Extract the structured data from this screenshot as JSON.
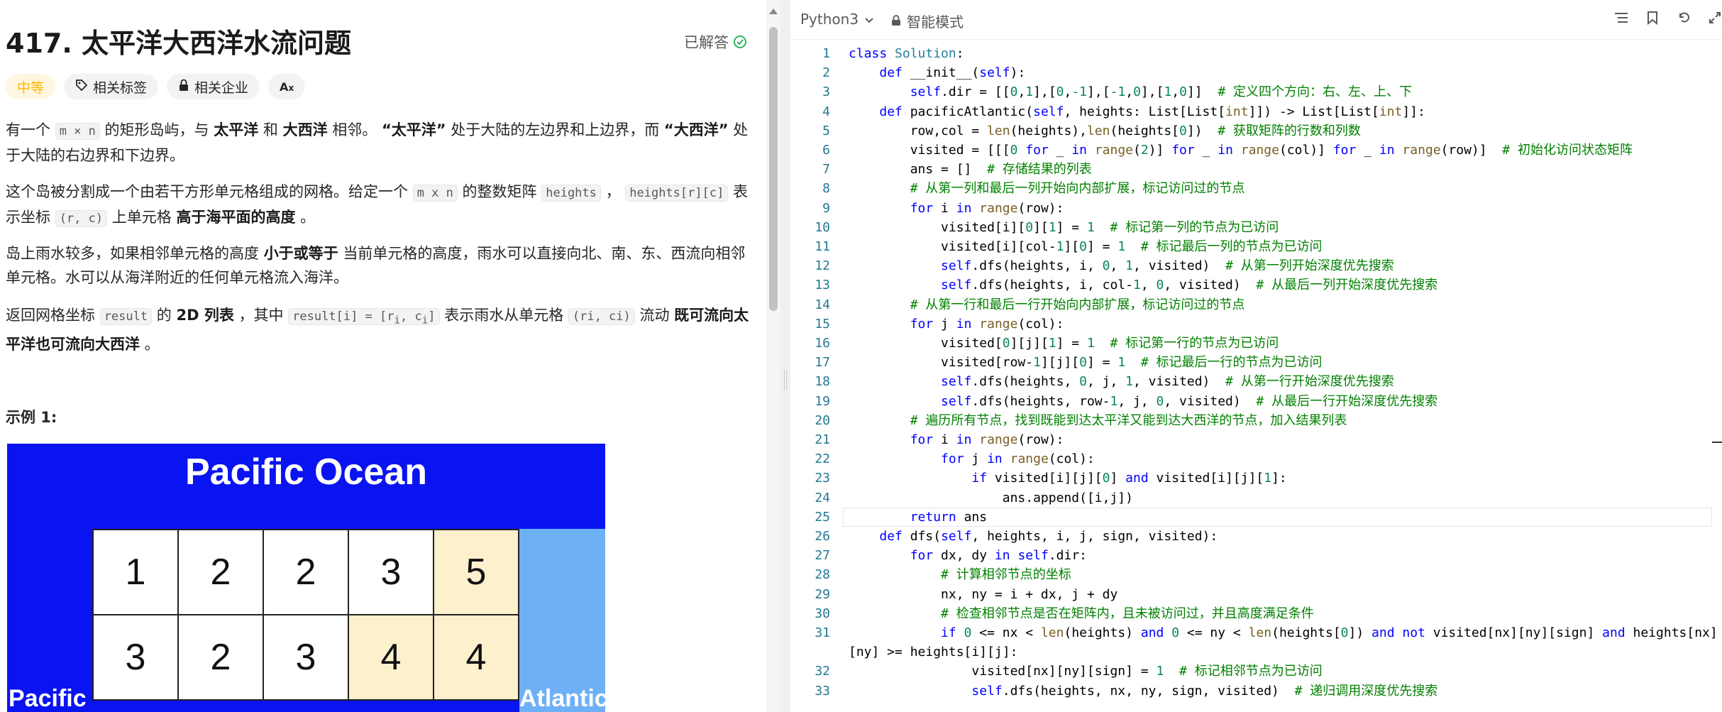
{
  "problem": {
    "title": "417. 太平洋大西洋水流问题",
    "status": "已解答",
    "difficulty": "中等",
    "tags": [
      "相关标签",
      "相关企业",
      "Aあ"
    ],
    "example_title": "示例 1:"
  },
  "example_image": {
    "top_label": "Pacific Ocean",
    "left_label": "Pacific",
    "right_label": "Atlantic",
    "cells": [
      {
        "v": "1",
        "hl": false
      },
      {
        "v": "2",
        "hl": false
      },
      {
        "v": "2",
        "hl": false
      },
      {
        "v": "3",
        "hl": false
      },
      {
        "v": "5",
        "hl": true
      },
      {
        "v": "3",
        "hl": false
      },
      {
        "v": "2",
        "hl": false
      },
      {
        "v": "3",
        "hl": false
      },
      {
        "v": "4",
        "hl": true
      },
      {
        "v": "4",
        "hl": true
      }
    ]
  },
  "editor": {
    "language": "Python3",
    "mode": "智能模式",
    "lines": [
      "class Solution:",
      "    def __init__(self):",
      "        self.dir = [[0,1],[0,-1],[-1,0],[1,0]]  # 定义四个方向：右、左、上、下",
      "    def pacificAtlantic(self, heights: List[List[int]]) -> List[List[int]]:",
      "        row,col = len(heights),len(heights[0])  # 获取矩阵的行数和列数",
      "        visited = [[[0 for _ in range(2)] for _ in range(col)] for _ in range(row)]  # 初始化访问状态矩阵",
      "        ans = []  # 存储结果的列表",
      "        # 从第一列和最后一列开始向内部扩展，标记访问过的节点",
      "        for i in range(row):",
      "            visited[i][0][1] = 1  # 标记第一列的节点为已访问",
      "            visited[i][col-1][0] = 1  # 标记最后一列的节点为已访问",
      "            self.dfs(heights, i, 0, 1, visited)  # 从第一列开始深度优先搜索",
      "            self.dfs(heights, i, col-1, 0, visited)  # 从最后一列开始深度优先搜索",
      "        # 从第一行和最后一行开始向内部扩展，标记访问过的节点",
      "        for j in range(col):",
      "            visited[0][j][1] = 1  # 标记第一行的节点为已访问",
      "            visited[row-1][j][0] = 1  # 标记最后一行的节点为已访问",
      "            self.dfs(heights, 0, j, 1, visited)  # 从第一行开始深度优先搜索",
      "            self.dfs(heights, row-1, j, 0, visited)  # 从最后一行开始深度优先搜索",
      "        # 遍历所有节点，找到既能到达太平洋又能到达大西洋的节点，加入结果列表",
      "        for i in range(row):",
      "            for j in range(col):",
      "                if visited[i][j][0] and visited[i][j][1]:",
      "                    ans.append([i,j])",
      "        return ans",
      "    def dfs(self, heights, i, j, sign, visited):",
      "        for dx, dy in self.dir:",
      "            # 计算相邻节点的坐标",
      "            nx, ny = i + dx, j + dy",
      "            # 检查相邻节点是否在矩阵内，且未被访问过，并且高度满足条件",
      "            if 0 <= nx < len(heights) and 0 <= ny < len(heights[0]) and not visited[nx][ny][sign] and heights[nx]",
      "[ny] >= heights[i][j]:",
      "                visited[nx][ny][sign] = 1  # 标记相邻节点为已访问",
      "                self.dfs(heights, nx, ny, sign, visited)  # 递归调用深度优先搜索"
    ],
    "line_numbers": [
      "1",
      "2",
      "3",
      "4",
      "5",
      "6",
      "7",
      "8",
      "9",
      "10",
      "11",
      "12",
      "13",
      "14",
      "15",
      "16",
      "17",
      "18",
      "19",
      "20",
      "21",
      "22",
      "23",
      "24",
      "25",
      "26",
      "27",
      "28",
      "29",
      "30",
      "31",
      "",
      "32",
      "33"
    ]
  },
  "colors": {
    "keyword": "#0000ff",
    "class_name": "#267f99",
    "function": "#795e26",
    "number": "#098658",
    "comment": "#008000",
    "line_number": "#237893",
    "difficulty": "#ffb800",
    "solved_check": "#2db55d",
    "ocean_blue": "#0a14f0",
    "atlantic_blue": "#6eb0f5",
    "cell_highlight": "#fdf0cc"
  },
  "icons": [
    "tag-icon",
    "lock-icon",
    "check-circle-icon",
    "chevron-down-icon",
    "list-icon",
    "bookmark-icon",
    "undo-icon",
    "expand-icon"
  ]
}
